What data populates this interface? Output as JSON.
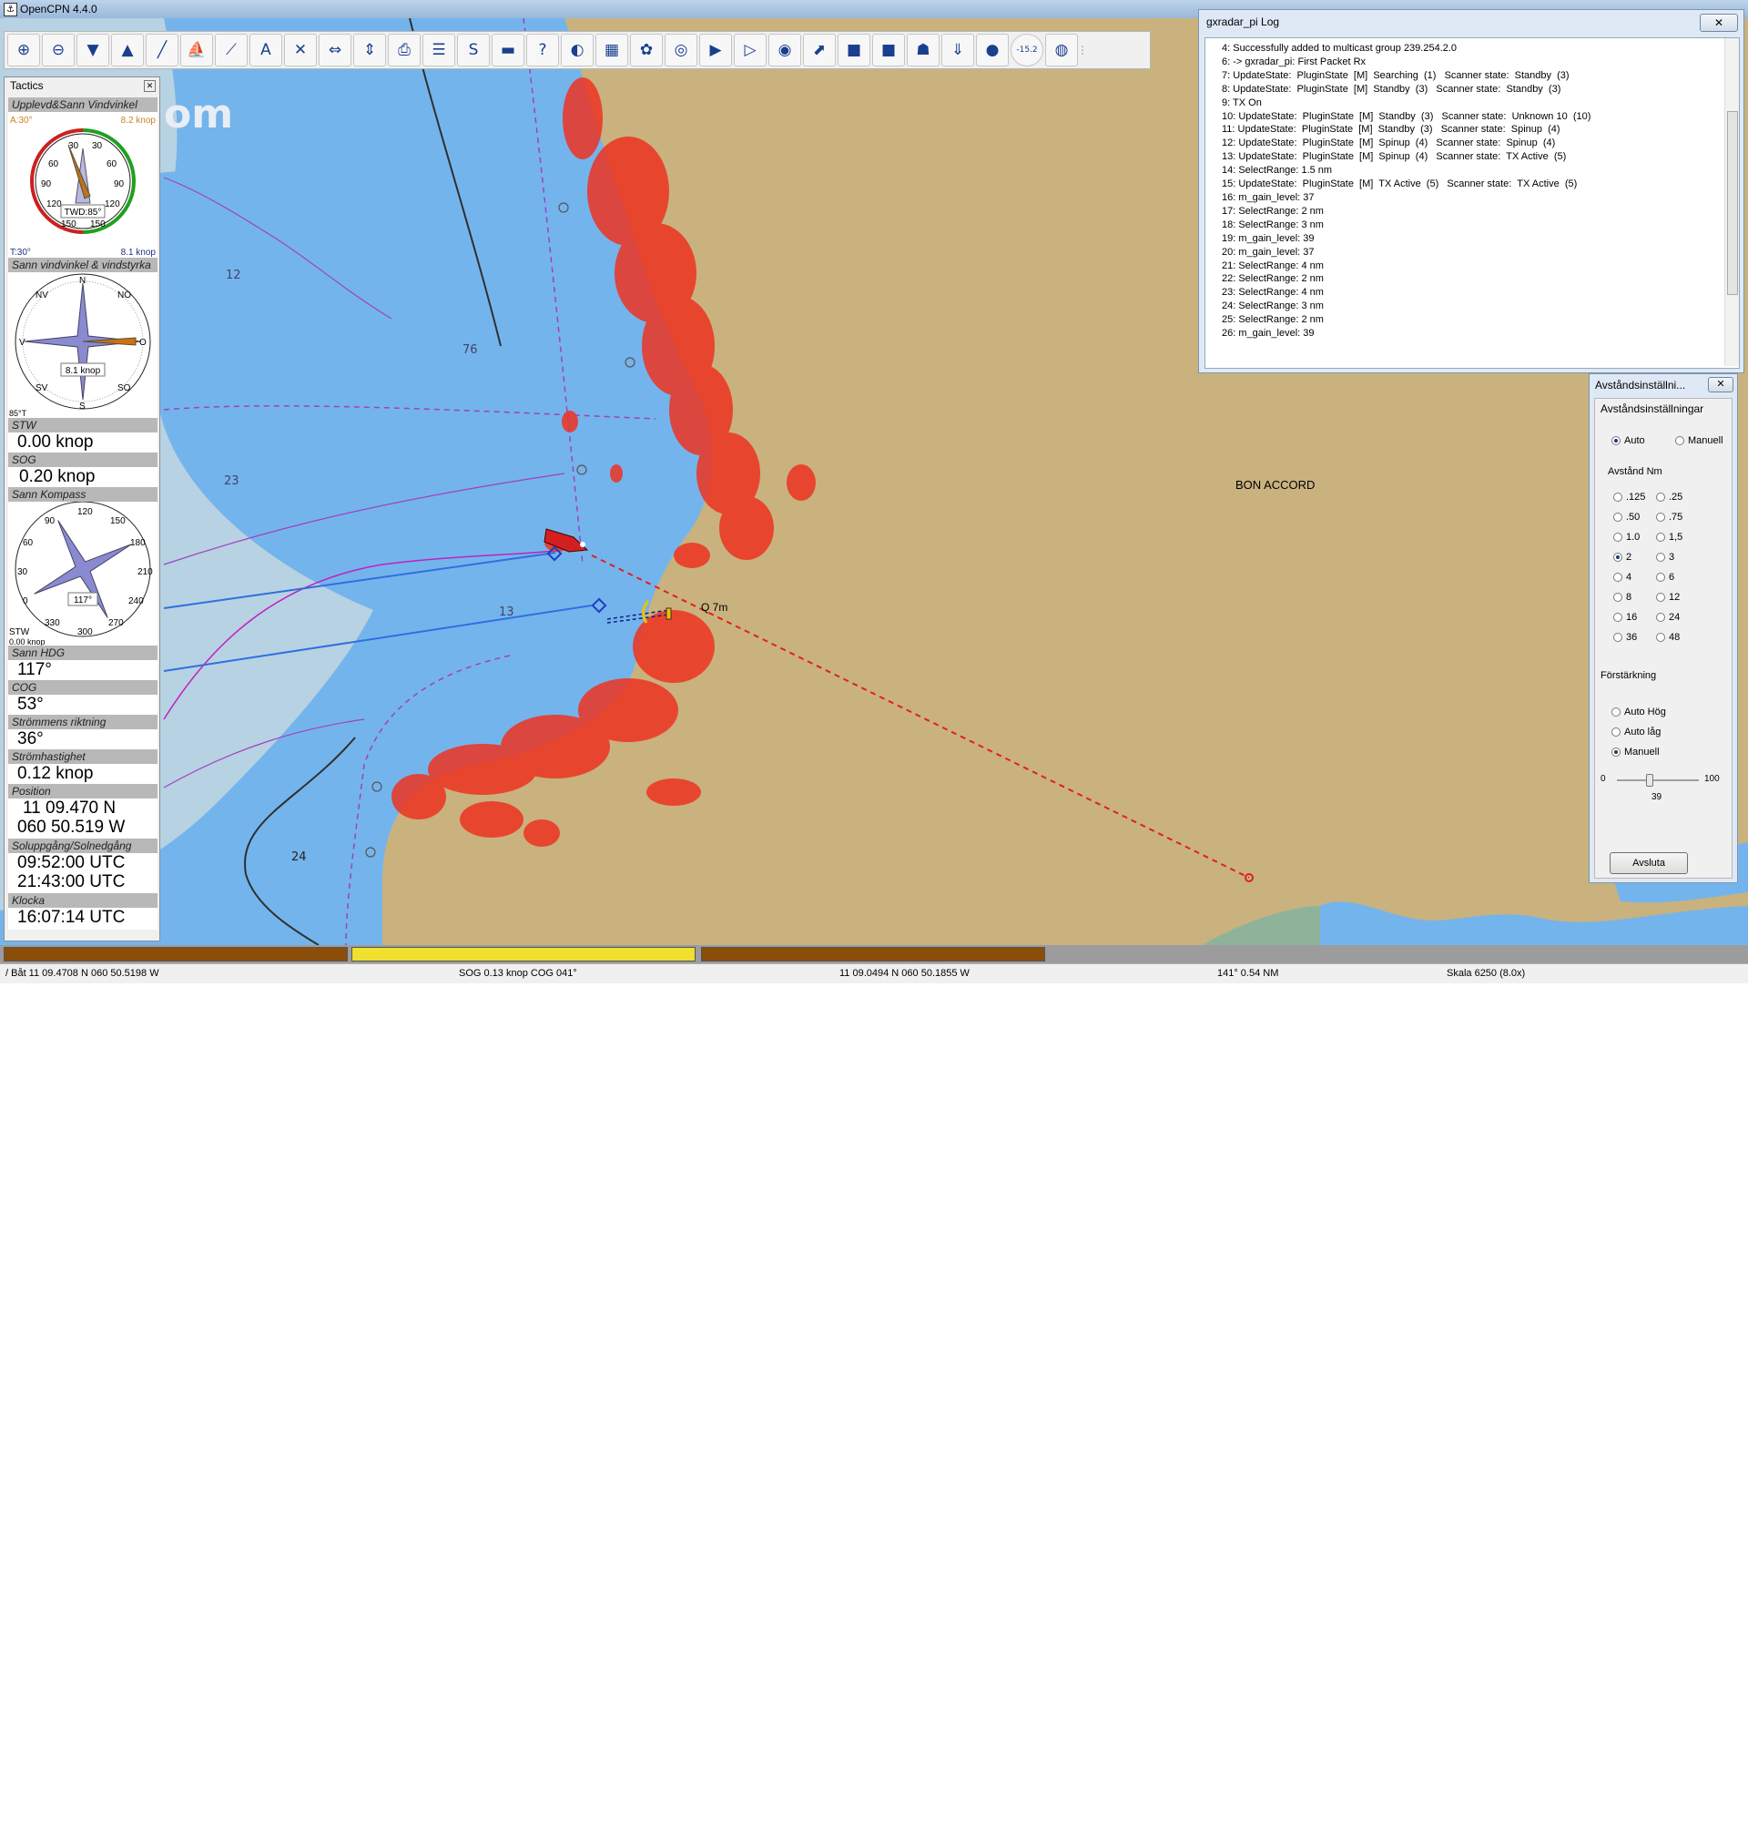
{
  "window": {
    "title": "OpenCPN 4.4.0"
  },
  "toolbar": {
    "items": [
      {
        "id": "zoom-in",
        "glyph": "⊕"
      },
      {
        "id": "zoom-out",
        "glyph": "⊖"
      },
      {
        "id": "scale-in",
        "glyph": "▼"
      },
      {
        "id": "scale-out",
        "glyph": "▲"
      },
      {
        "id": "route",
        "glyph": "╱"
      },
      {
        "id": "track",
        "glyph": "⛵"
      },
      {
        "id": "measure",
        "glyph": "⟋"
      },
      {
        "id": "text",
        "glyph": "A"
      },
      {
        "id": "tools",
        "glyph": "✕"
      },
      {
        "id": "autofollow",
        "glyph": "⇔"
      },
      {
        "id": "tides",
        "glyph": "⇕"
      },
      {
        "id": "print",
        "glyph": "⎙"
      },
      {
        "id": "route-manager",
        "glyph": "☰"
      },
      {
        "id": "current",
        "glyph": "S"
      },
      {
        "id": "color-scheme",
        "glyph": "▬"
      },
      {
        "id": "help",
        "glyph": "?"
      },
      {
        "id": "night",
        "glyph": "◐"
      },
      {
        "id": "chart-layers",
        "glyph": "▦"
      },
      {
        "id": "grib",
        "glyph": "✿"
      },
      {
        "id": "radar",
        "glyph": "◎"
      },
      {
        "id": "tactics-toggle",
        "glyph": "▶"
      },
      {
        "id": "polar",
        "glyph": "▷"
      },
      {
        "id": "sounder",
        "glyph": "◉"
      },
      {
        "id": "weather-routing",
        "glyph": "⬈"
      },
      {
        "id": "logbook",
        "glyph": "■"
      },
      {
        "id": "logbook2",
        "glyph": "■"
      },
      {
        "id": "sled",
        "glyph": "☗"
      },
      {
        "id": "download",
        "glyph": "⇓"
      },
      {
        "id": "earth",
        "glyph": "●"
      },
      {
        "id": "calibrate",
        "glyph": "-15.2"
      },
      {
        "id": "mob",
        "glyph": "◍"
      }
    ]
  },
  "chart": {
    "place_label": "BON ACCORD",
    "overlay_text": "om",
    "depth_labels": [
      "12",
      "76",
      "23",
      "24",
      "13"
    ],
    "range_label": "Q 7m"
  },
  "tactics": {
    "title": "Tactics",
    "wind_gauge": {
      "caption": "Upplevd&Sann Vindvinkel",
      "apparent_angle": "A:30°",
      "apparent_speed": "8.2 knop",
      "true_angle": "T:30°",
      "true_speed": "8.1 knop",
      "twd": "TWD:85°",
      "ticks": [
        "30",
        "60",
        "90",
        "120",
        "150",
        "150",
        "120",
        "90",
        "60",
        "30"
      ]
    },
    "true_wind_gauge": {
      "caption": "Sann vindvinkel & vindstyrka",
      "speed": "8.1 knop",
      "corner": "85°T",
      "dirs": [
        "N",
        "NO",
        "O",
        "SO",
        "S",
        "SV",
        "V",
        "NV"
      ]
    },
    "stw": {
      "caption": "STW",
      "value": "0.00 knop"
    },
    "sog": {
      "caption": "SOG",
      "value": "0.20 knop"
    },
    "compass": {
      "caption": "Sann Kompass",
      "heading": "117°",
      "stw_label": "STW",
      "stw_value": "0.00 knop",
      "ticks": [
        "120",
        "150",
        "180",
        "210",
        "240",
        "270",
        "300",
        "330",
        "0",
        "30",
        "60",
        "90"
      ]
    },
    "hdg": {
      "caption": "Sann HDG",
      "value": "117°"
    },
    "cog": {
      "caption": "COG",
      "value": "53°"
    },
    "current_dir": {
      "caption": "Strömmens riktning",
      "value": "36°"
    },
    "current_speed": {
      "caption": "Strömhastighet",
      "value": "0.12 knop"
    },
    "position": {
      "caption": "Position",
      "lat": "11 09.470 N",
      "lon": "060 50.519 W"
    },
    "sun": {
      "caption": "Soluppgång/Solnedgång",
      "rise": "09:52:00 UTC",
      "set": "21:43:00 UTC"
    },
    "clock": {
      "caption": "Klocka",
      "value": "16:07:14 UTC"
    }
  },
  "log": {
    "title": "gxradar_pi Log",
    "close": "✕",
    "lines": [
      "4: Successfully added to multicast group 239.254.2.0",
      "6: -> gxradar_pi: First Packet Rx",
      "7: UpdateState:  PluginState  [M]  Searching  (1)   Scanner state:  Standby  (3)",
      "8: UpdateState:  PluginState  [M]  Standby  (3)   Scanner state:  Standby  (3)",
      "9: TX On",
      "10: UpdateState:  PluginState  [M]  Standby  (3)   Scanner state:  Unknown 10  (10)",
      "11: UpdateState:  PluginState  [M]  Standby  (3)   Scanner state:  Spinup  (4)",
      "12: UpdateState:  PluginState  [M]  Spinup  (4)   Scanner state:  Spinup  (4)",
      "13: UpdateState:  PluginState  [M]  Spinup  (4)   Scanner state:  TX Active  (5)",
      "14: SelectRange: 1.5 nm",
      "15: UpdateState:  PluginState  [M]  TX Active  (5)   Scanner state:  TX Active  (5)",
      "16: m_gain_level: 37",
      "17: SelectRange: 2 nm",
      "18: SelectRange: 3 nm",
      "19: m_gain_level: 39",
      "20: m_gain_level: 37",
      "21: SelectRange: 4 nm",
      "22: SelectRange: 2 nm",
      "23: SelectRange: 4 nm",
      "24: SelectRange: 3 nm",
      "25: SelectRange: 2 nm",
      "26: m_gain_level: 39"
    ]
  },
  "range_dialog": {
    "title": "Avståndsinställni...",
    "close": "✕",
    "group_title": "Avståndsinställningar",
    "mode_auto": "Auto",
    "mode_manual": "Manuell",
    "mode_selected": "Auto",
    "range_title": "Avstånd Nm",
    "ranges": [
      ".125",
      ".25",
      ".50",
      ".75",
      "1.0",
      "1,5",
      "2",
      "3",
      "4",
      "6",
      "8",
      "12",
      "16",
      "24",
      "36",
      "48"
    ],
    "range_selected": "2",
    "gain_title": "Förstärkning",
    "gain_auto_high": "Auto Hög",
    "gain_auto_low": "Auto låg",
    "gain_manual": "Manuell",
    "gain_selected": "Manuell",
    "slider_min": "0",
    "slider_max": "100",
    "slider_value": "39",
    "slider_fraction": 0.39,
    "close_button": "Avsluta"
  },
  "status": {
    "boat": "/ Båt 11 09.4708 N   060 50.5198 W",
    "sog_cog": "SOG 0.13 knop   COG 041°",
    "cursor": "11 09.0494 N   060 50.1855 W",
    "bearing": "141°  0.54 NM",
    "scale": "Skala 6250 (8.0x)"
  },
  "colors": {
    "land": "#c9b27e",
    "deep_water": "#74b4ec",
    "shallow_water": "#b7d2e2",
    "radar_echo": "#ee3322",
    "progress_brown": "#8a4e0a",
    "progress_yellow": "#f0e030"
  }
}
